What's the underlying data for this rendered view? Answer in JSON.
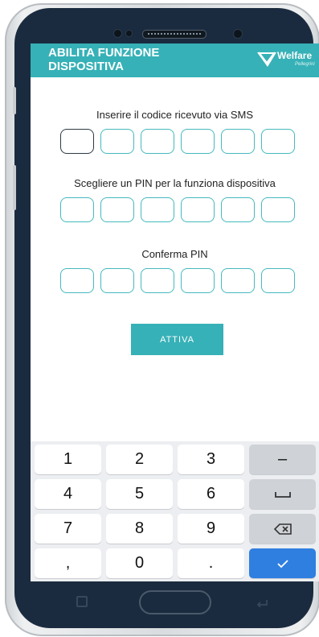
{
  "header": {
    "title": "ABILITA FUNZIONE DISPOSITIVA",
    "logo_word": "Welfare",
    "logo_sub": "Pellegrini",
    "color": "#36b1b7"
  },
  "form": {
    "sms_label": "Inserire il codice ricevuto via SMS",
    "pin_label": "Scegliere un PIN per la funziona dispositiva",
    "confirm_label": "Conferma PIN",
    "sms_code": [
      "",
      "",
      "",
      "",
      "",
      ""
    ],
    "pin": [
      "",
      "",
      "",
      "",
      "",
      ""
    ],
    "confirm_pin": [
      "",
      "",
      "",
      "",
      "",
      ""
    ],
    "submit_label": "ATTIVA"
  },
  "keypad": {
    "keys": [
      "1",
      "2",
      "3",
      "–",
      "4",
      "5",
      "6",
      "space",
      "7",
      "8",
      "9",
      "backspace",
      ",",
      "0",
      ".",
      "done"
    ]
  },
  "icons": {
    "nav_recent": "recent-apps-icon",
    "nav_home": "home-button",
    "nav_back": "back-icon",
    "space": "space-bar-icon",
    "backspace": "backspace-icon",
    "done": "check-icon"
  }
}
